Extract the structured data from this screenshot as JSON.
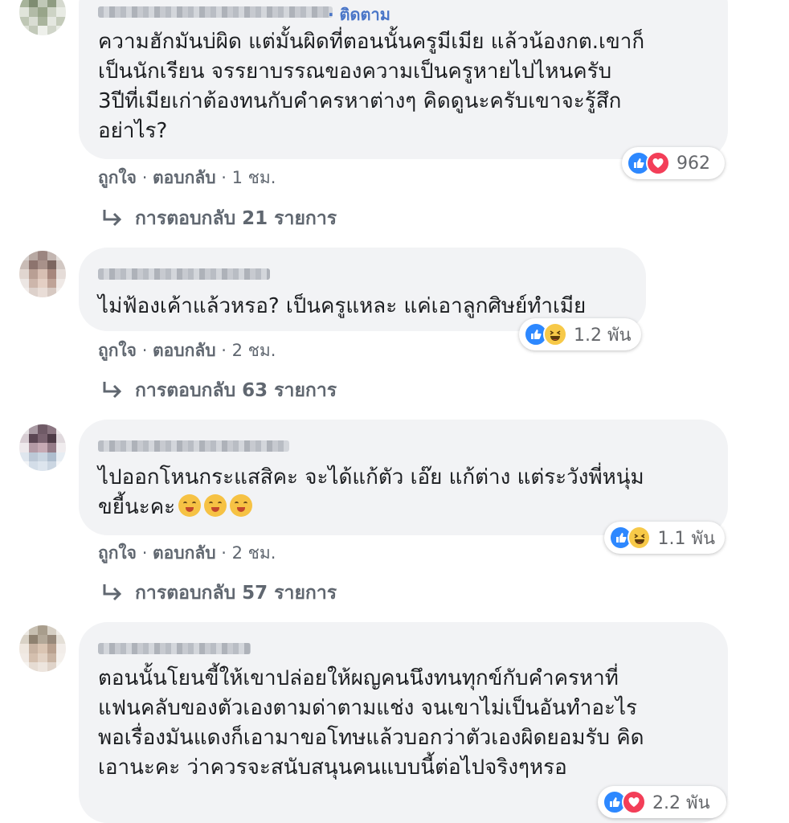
{
  "colors": {
    "bubble": "#f2f3f5",
    "link_blue": "#4a76c8",
    "meta_gray": "#606770",
    "like_blue": "#2d88ff",
    "love_red": "#f33e58",
    "haha_yellow": "#f7c948"
  },
  "comments": [
    {
      "follow_label": "· ติดตาม",
      "text": "ความฮักมันบ่ผิด แต่มั้นผิดที่ตอนนั้นครูมีเมีย แล้วน้องกต.เขาก็\nเป็นนักเรียน จรรยาบรรณของความเป็นครูหายไปไหนครับ\n3ปีที่เมียเก่าต้องทนกับคำครหาต่างๆ คิดดูนะครับเขาจะรู้สึก\nอย่าไร?",
      "reactions": [
        "like-icon",
        "love-icon"
      ],
      "reaction_count": "962",
      "like_label": "ถูกใจ",
      "reply_label": "ตอบกลับ",
      "time": "1 ชม.",
      "replies_label": "การตอบกลับ 21 รายการ"
    },
    {
      "text": "ไม่ฟ้องเค้าแล้วหรอ? เป็นครูแหละ แค่เอาลูกศิษย์ทำเมีย",
      "reactions": [
        "like-icon",
        "haha-icon"
      ],
      "reaction_count": "1.2 พัน",
      "like_label": "ถูกใจ",
      "reply_label": "ตอบกลับ",
      "time": "2 ชม.",
      "replies_label": "การตอบกลับ 63 รายการ"
    },
    {
      "text": "ไปออกโหนกระแสสิคะ จะได้แก้ตัว เอ๊ย แก้ต่าง แต่ระวังพี่หนุ่ม\nขยี้นะคะ",
      "emojis": [
        "smile-emoji",
        "smile-emoji",
        "smile-emoji"
      ],
      "reactions": [
        "like-icon",
        "haha-icon"
      ],
      "reaction_count": "1.1 พัน",
      "like_label": "ถูกใจ",
      "reply_label": "ตอบกลับ",
      "time": "2 ชม.",
      "replies_label": "การตอบกลับ 57 รายการ"
    },
    {
      "text": "ตอนนั้นโยนขี้ให้เขาปล่อยให้ผญคนนึงทนทุกข์กับคำครหาที่\nแฟนคลับของตัวเองตามด่าตามแช่ง จนเขาไม่เป็นอันทำอะไร\nพอเรื่องมันแดงก็เอามาขอโทษแล้วบอกว่าตัวเองผิดยอมรับ คิด\nเอานะคะ ว่าควรจะสนับสนุนคนแบบนี้ต่อไปจริงๆหรอ",
      "reactions": [
        "like-icon",
        "love-icon"
      ],
      "reaction_count": "2.2 พัน"
    }
  ]
}
